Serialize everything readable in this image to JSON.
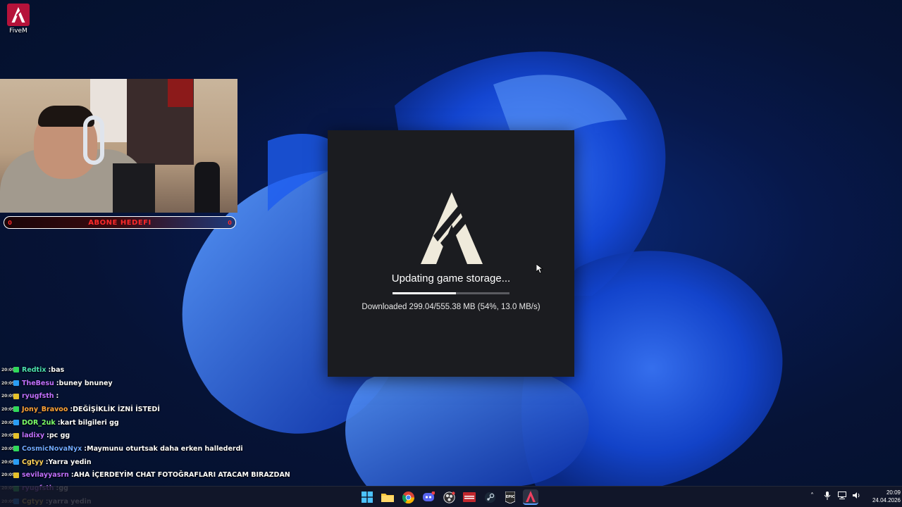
{
  "desktop": {
    "icons": [
      {
        "label": "FiveM",
        "icon": "fivem-logo-icon",
        "color": "#b5123a"
      }
    ]
  },
  "overlay": {
    "sub_goal": {
      "title": "ABONE HEDEFI",
      "left_value": "0",
      "right_value": "0",
      "accent": "#ff2a2a"
    }
  },
  "chat": {
    "messages": [
      {
        "time": "20:09",
        "user": "Redtix",
        "user_color": "#4be0b0",
        "message": "bas"
      },
      {
        "time": "20:09",
        "user": "TheBesu",
        "user_color": "#c070ff",
        "message": "buney bnuney"
      },
      {
        "time": "20:09",
        "user": "ryugfsth",
        "user_color": "#c070ff",
        "message": ""
      },
      {
        "time": "20:09",
        "user": "Jony_Bravoo",
        "user_color": "#ffa43a",
        "message": "DEĞİŞİKLİK İZNİ İSTEDİ"
      },
      {
        "time": "20:09",
        "user": "DOR_2uk",
        "user_color": "#7cff6a",
        "message": "kart bilgileri gg"
      },
      {
        "time": "20:09",
        "user": "ladixy",
        "user_color": "#c070ff",
        "message": "pc gg"
      },
      {
        "time": "20:09",
        "user": "CosmicNovaNyx",
        "user_color": "#6fa8ff",
        "message": "Maymunu oturtsak daha erken hallederdi"
      },
      {
        "time": "20:09",
        "user": "Cgtyy",
        "user_color": "#ffd35a",
        "message": "Yarra yedin"
      },
      {
        "time": "20:09",
        "user": "sevilayyasrn",
        "user_color": "#c070ff",
        "message": "AHA İÇERDEYİM CHAT FOTOĞRAFLARI ATACAM BIRAZDAN"
      },
      {
        "time": "20:09",
        "user": "ryugfsth",
        "user_color": "#c070ff",
        "message": "gg"
      },
      {
        "time": "20:09",
        "user": "Cgtyy",
        "user_color": "#ffd35a",
        "message": "yarra yedin"
      }
    ]
  },
  "dialog": {
    "status": "Updating game storage...",
    "progress": 0.54,
    "detail": "Downloaded 299.04/555.38 MB (54%, 13.0 MB/s)",
    "logo_icon": "fivem-logo-icon"
  },
  "taskbar": {
    "apps": [
      {
        "name": "start",
        "icon": "windows-start-icon"
      },
      {
        "name": "file-explorer",
        "icon": "folder-icon"
      },
      {
        "name": "chrome",
        "icon": "chrome-icon"
      },
      {
        "name": "discord",
        "icon": "discord-icon"
      },
      {
        "name": "obs",
        "icon": "obs-icon"
      },
      {
        "name": "capture",
        "icon": "capture-app-icon"
      },
      {
        "name": "steam",
        "icon": "steam-icon"
      },
      {
        "name": "epic-games",
        "icon": "epic-games-icon"
      },
      {
        "name": "fivem",
        "icon": "fivem-logo-icon",
        "active": true
      }
    ],
    "clock": {
      "time": "20:09",
      "date": "24.04.2026"
    }
  }
}
